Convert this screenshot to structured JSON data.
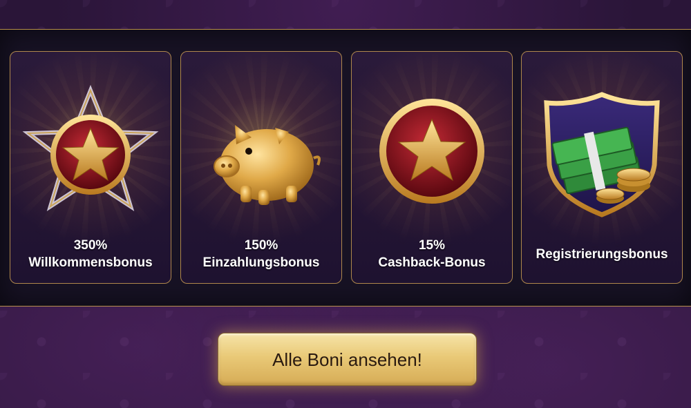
{
  "bonuses": [
    {
      "amount": "350%",
      "name": "Willkommensbonus",
      "icon": "star-emblem-icon"
    },
    {
      "amount": "150%",
      "name": "Einzahlungsbonus",
      "icon": "piggy-bank-icon"
    },
    {
      "amount": "15%",
      "name": "Cashback-Bonus",
      "icon": "star-coin-icon"
    },
    {
      "amount": "",
      "name": "Registrierungsbonus",
      "icon": "money-shield-icon"
    }
  ],
  "cta": {
    "label": "Alle Boni ansehen!"
  },
  "colors": {
    "gold": "#d9b15c",
    "ruby": "#8a1020",
    "background": "#2a1538",
    "panel": "#171224"
  }
}
